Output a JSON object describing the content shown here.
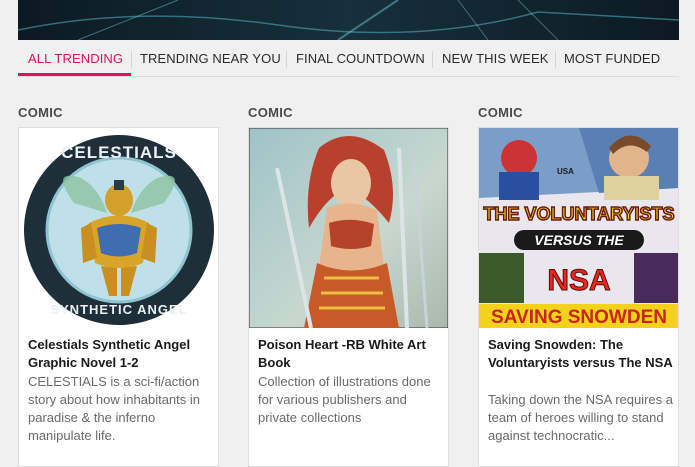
{
  "tabs": [
    {
      "label": "ALL TRENDING",
      "active": true
    },
    {
      "label": "TRENDING NEAR YOU",
      "active": false
    },
    {
      "label": "FINAL COUNTDOWN",
      "active": false
    },
    {
      "label": "NEW THIS WEEK",
      "active": false
    },
    {
      "label": "MOST FUNDED",
      "active": false
    }
  ],
  "accent_color": "#e0115f",
  "projects": [
    {
      "category": "COMIC",
      "image_icon": "celestials-logo-image",
      "image_text_top": "CELESTIALS",
      "image_text_bottom": "SYNTHETIC ANGEL",
      "title": "Celestials Synthetic Angel Graphic Novel 1-2",
      "description": "CELESTIALS is a sci-fi/action story about how inhabitants in paradise & the inferno manipulate life."
    },
    {
      "category": "COMIC",
      "image_icon": "poison-heart-illustration-image",
      "title": "Poison Heart -RB White Art Book",
      "description": "Collection of illustrations done for various publishers and private collections"
    },
    {
      "category": "COMIC",
      "image_icon": "saving-snowden-cover-image",
      "image_text_1": "THE VOLUNTARYISTS",
      "image_text_2": "VERSUS THE",
      "image_text_3": "NSA",
      "image_text_4": "SAVING SNOWDEN",
      "image_text_5": "USA",
      "title": "Saving Snowden: The Voluntaryists versus The NSA",
      "description": "Taking down the NSA requires a team of heroes willing to stand against technocratic..."
    }
  ]
}
